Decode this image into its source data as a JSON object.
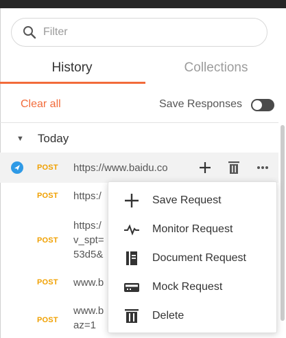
{
  "search": {
    "placeholder": "Filter",
    "value": ""
  },
  "tabs": [
    {
      "label": "History",
      "active": true
    },
    {
      "label": "Collections",
      "active": false
    }
  ],
  "toolbar": {
    "clear_all": "Clear all",
    "save_responses": "Save Responses",
    "save_responses_enabled": false
  },
  "group": {
    "label": "Today",
    "expanded": true
  },
  "history": [
    {
      "method": "POST",
      "url_lines": [
        "https://www.baidu.co"
      ],
      "hovered": true
    },
    {
      "method": "POST",
      "url_lines": [
        "https:/"
      ]
    },
    {
      "method": "POST",
      "url_lines": [
        "https:/",
        "v_spt=",
        "53d5&"
      ]
    },
    {
      "method": "POST",
      "url_lines": [
        "www.b"
      ]
    },
    {
      "method": "POST",
      "url_lines": [
        "www.b",
        "az=1"
      ]
    }
  ],
  "context_menu": {
    "items": [
      {
        "label": "Save Request",
        "icon": "plus-icon"
      },
      {
        "label": "Monitor Request",
        "icon": "monitor-pulse-icon"
      },
      {
        "label": "Document Request",
        "icon": "document-icon"
      },
      {
        "label": "Mock Request",
        "icon": "mock-server-icon"
      },
      {
        "label": "Delete",
        "icon": "trash-icon"
      }
    ]
  },
  "colors": {
    "accent": "#f26b3a",
    "method_post": "#f0a000",
    "sync_icon": "#2f9ae6",
    "top_strip": "#262626"
  }
}
